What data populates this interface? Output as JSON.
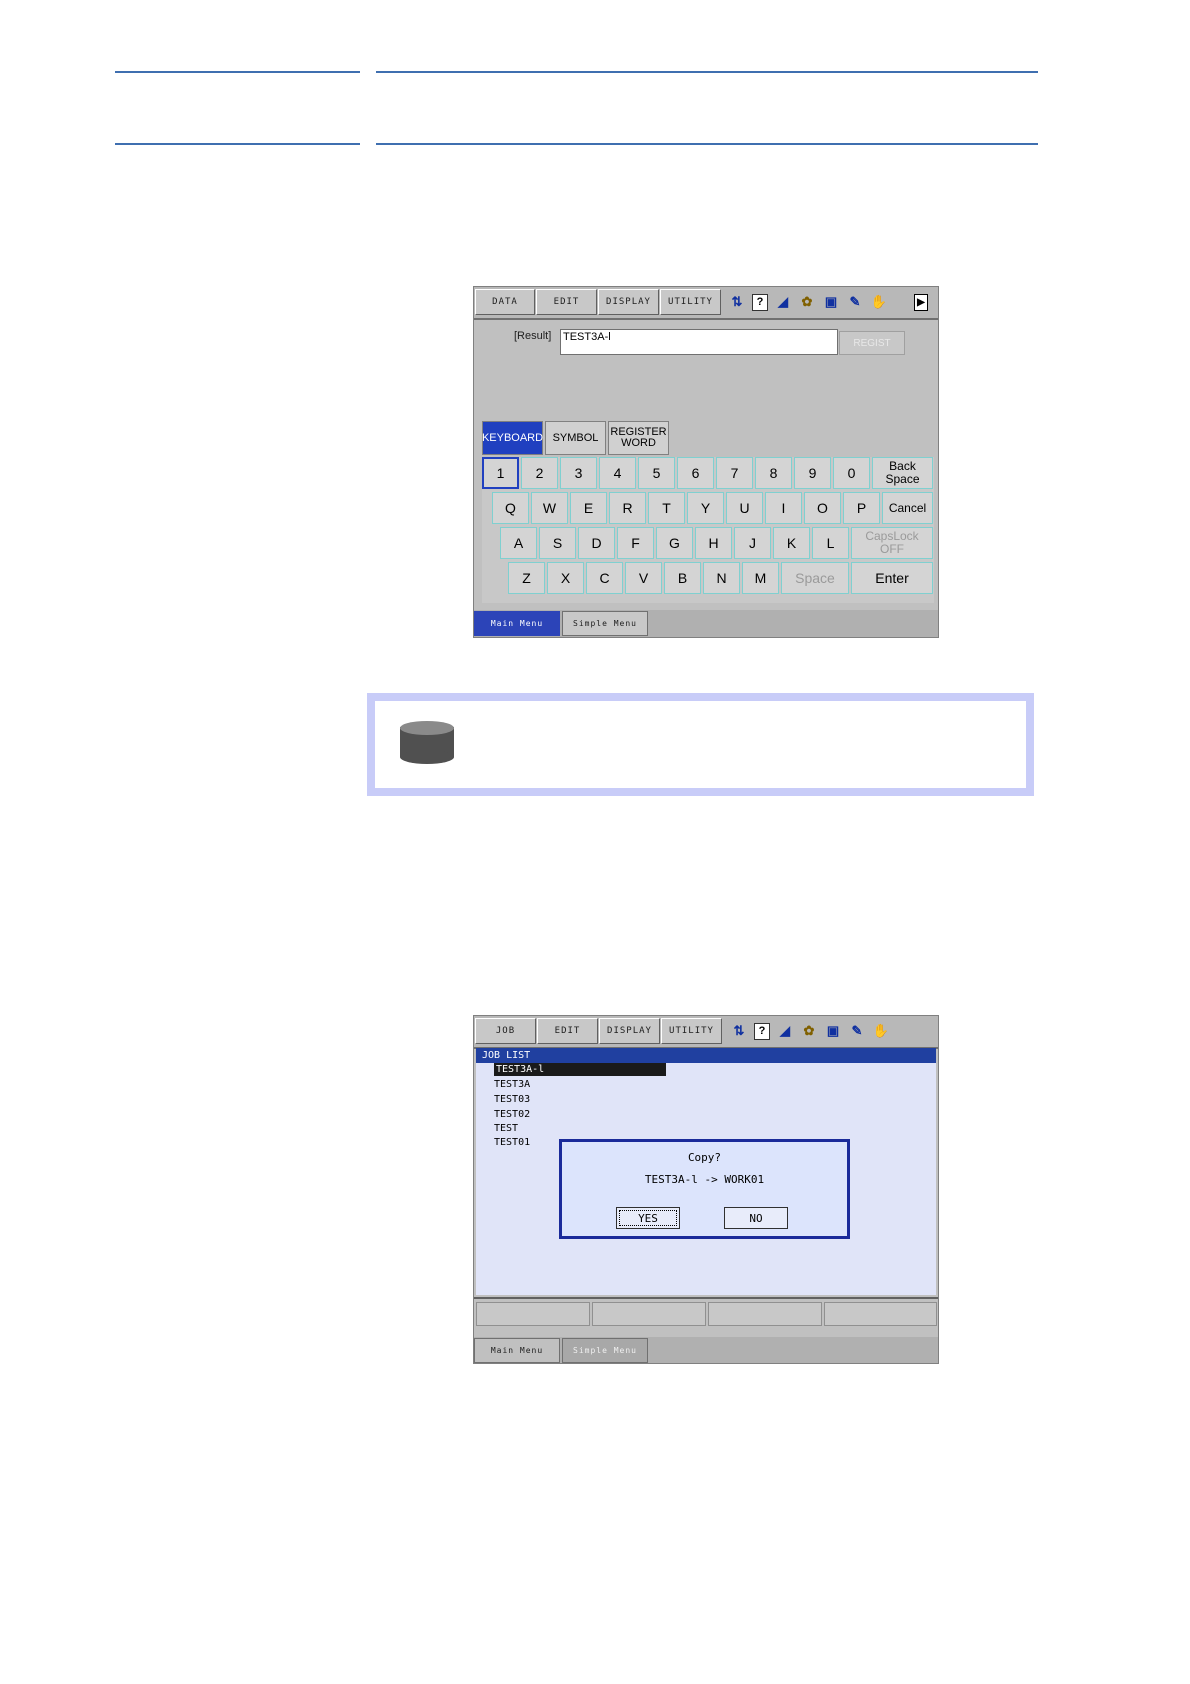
{
  "screen1": {
    "menu": [
      "DATA",
      "EDIT",
      "DISPLAY",
      "UTILITY"
    ],
    "icons": [
      "arrow-up-down-icon",
      "help-icon",
      "signal-icon",
      "gear-icon",
      "cell-icon",
      "edit-icon",
      "hand-icon",
      "play-icon"
    ],
    "result_label": "[Result]",
    "result_value": "TEST3A-l",
    "register_button": "REGIST",
    "tabs": [
      "KEYBOARD",
      "SYMBOL",
      "REGISTER WORD"
    ],
    "keys_row1": [
      "1",
      "2",
      "3",
      "4",
      "5",
      "6",
      "7",
      "8",
      "9",
      "0",
      "Back Space"
    ],
    "keys_row2": [
      "Q",
      "W",
      "E",
      "R",
      "T",
      "Y",
      "U",
      "I",
      "O",
      "P",
      "Cancel"
    ],
    "keys_row3": [
      "A",
      "S",
      "D",
      "F",
      "G",
      "H",
      "J",
      "K",
      "L",
      "CapsLock OFF"
    ],
    "keys_row4": [
      "Z",
      "X",
      "C",
      "V",
      "B",
      "N",
      "M",
      "Space",
      "Enter"
    ],
    "footer": [
      "Main Menu",
      "Simple Menu"
    ]
  },
  "screen2": {
    "menu": [
      "JOB",
      "EDIT",
      "DISPLAY",
      "UTILITY"
    ],
    "list_title": "JOB LIST",
    "jobs": [
      "TEST3A-l",
      "TEST3A",
      "TEST03",
      "TEST02",
      "TEST",
      "TEST01"
    ],
    "dialog": {
      "question": "Copy?",
      "detail": "TEST3A-l -> WORK01",
      "yes": "YES",
      "no": "NO"
    },
    "footer": [
      "Main Menu",
      "Simple Menu"
    ]
  },
  "colors": {
    "rule_blue": "#3f6fb0",
    "note_border": "#c8ccf8",
    "active_tab": "#2040c0",
    "dialog_border": "#1a2a9a"
  }
}
